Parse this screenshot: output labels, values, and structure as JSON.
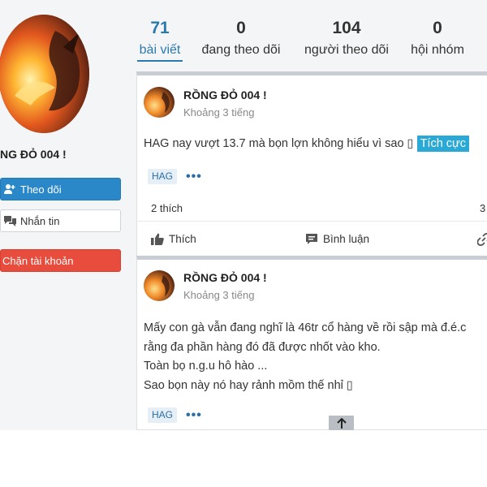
{
  "profile": {
    "name": "NG ĐỎ 004 !",
    "follow_button": "Theo dõi",
    "message_button": "Nhắn tin",
    "block_button": "Chặn tài khoản"
  },
  "stats": [
    {
      "value": "71",
      "label": "bài viết"
    },
    {
      "value": "0",
      "label": "đang theo dõi"
    },
    {
      "value": "104",
      "label": "người theo dõi"
    },
    {
      "value": "0",
      "label": "hội nhóm"
    }
  ],
  "posts": [
    {
      "author": "RỒNG ĐỎ 004 !",
      "time": "Khoảng 3 tiếng",
      "lines": [
        "HAG nay vượt 13.7 mà bọn lợn không hiểu vì sao ▯"
      ],
      "highlight": "Tích cực",
      "tag": "HAG",
      "more": "•••",
      "likes": "2 thích",
      "comments_count": "3",
      "action_like": "Thích",
      "action_comment": "Bình luận"
    },
    {
      "author": "RỒNG ĐỎ 004 !",
      "time": "Khoảng 3 tiếng",
      "lines": [
        "Mấy con gà vẫn đang nghĩ là 46tr cổ hàng về rồi sập mà đ.é.c",
        "rằng đa phần hàng đó đã được nhốt vào kho.",
        "Toàn bọ n.g.u hô hào ...",
        "Sao bọn này nó hay rảnh mồm thế nhỉ ▯"
      ],
      "tag": "HAG",
      "more": "•••"
    }
  ],
  "icons": {
    "follow": "add-user-icon",
    "message": "chat-icon",
    "like": "thumbs-up-icon",
    "comment": "comment-icon",
    "share": "link-icon",
    "scroll_top": "arrow-up-icon"
  },
  "colors": {
    "accent": "#2a7ab0",
    "follow_button": "#2a88c8",
    "block_button": "#e74c3c",
    "highlight": "#2aa9d6"
  }
}
